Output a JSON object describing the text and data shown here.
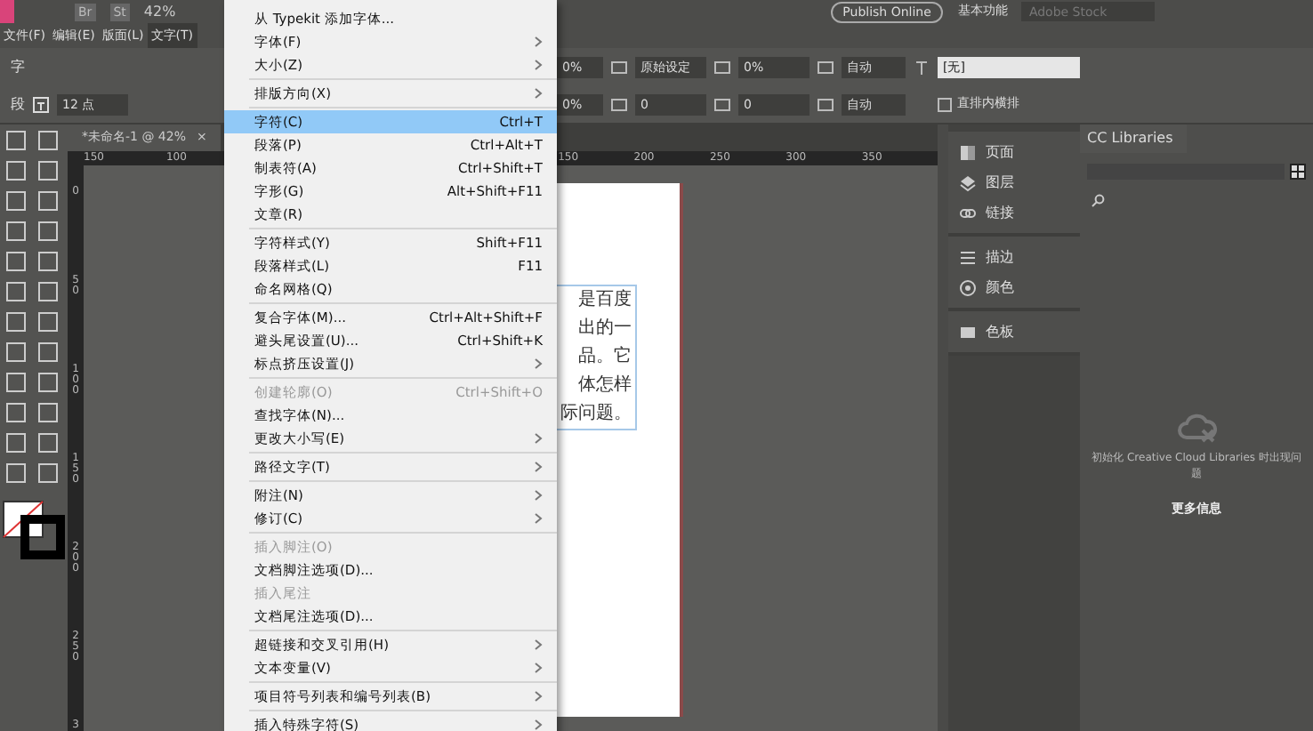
{
  "app_bar": {
    "bridge": "Br",
    "stock": "St",
    "zoom": "42%",
    "publish_button": "Publish Online",
    "workspace": "基本功能",
    "search": {
      "placeholder": "Adobe Stock"
    }
  },
  "menu_bar": [
    {
      "label": "文件(F)",
      "selected": false
    },
    {
      "label": "编辑(E)",
      "selected": false
    },
    {
      "label": "版面(L)",
      "selected": false
    },
    {
      "label": "文字(T)",
      "selected": true
    }
  ],
  "control_panel": {
    "row_1_left_label": "字",
    "row_2_left_label": "段",
    "font_size": "12 点",
    "tracking_percent": "0%",
    "kerning": "原始设定",
    "baseline_percent": "0%",
    "grid_top": "自动",
    "style": "[无]",
    "scale_percent": "0%",
    "tracking": "0",
    "shift": "0",
    "grid_bottom": "自动",
    "tate_chu_yoko": {
      "label": "直排内横排",
      "checked": false
    }
  },
  "document_tab": {
    "title": "*未命名-1 @ 42%",
    "close": "×"
  },
  "horizontal_ruler": {
    "ticks_before_menu": [
      "150",
      "100"
    ],
    "ticks_after_menu": [
      "150",
      "200",
      "250",
      "300",
      "350"
    ]
  },
  "vertical_ruler": {
    "ticks": [
      "0",
      "50",
      "100",
      "150",
      "200",
      "250",
      "3"
    ]
  },
  "page_text": [
    "是百度",
    "出的一",
    "品。它",
    "体怎样",
    "际问题。"
  ],
  "panels": [
    [
      {
        "label": "页面",
        "kind": "pages"
      },
      {
        "label": "图层",
        "kind": "layers"
      },
      {
        "label": "链接",
        "kind": "links"
      }
    ],
    [
      {
        "label": "描边",
        "kind": "stroke"
      },
      {
        "label": "颜色",
        "kind": "color"
      }
    ],
    [
      {
        "label": "色板",
        "kind": "swatches"
      }
    ]
  ],
  "cc_libraries": {
    "title": "CC Libraries",
    "message": "初始化 Creative Cloud Libraries 时出现问题",
    "more_info": "更多信息"
  },
  "type_menu": [
    [
      {
        "label": "从 Typekit 添加字体...",
        "submenu": false,
        "disabled": false,
        "selected": false
      },
      {
        "label": "字体(F)",
        "submenu": true,
        "disabled": false,
        "selected": false
      },
      {
        "label": "大小(Z)",
        "submenu": true,
        "disabled": false,
        "selected": false
      }
    ],
    [
      {
        "label": "排版方向(X)",
        "submenu": true,
        "disabled": false,
        "selected": false
      }
    ],
    [
      {
        "label": "字符(C)",
        "shortcut": "Ctrl+T",
        "submenu": false,
        "disabled": false,
        "selected": true
      },
      {
        "label": "段落(P)",
        "shortcut": "Ctrl+Alt+T",
        "submenu": false,
        "disabled": false,
        "selected": false
      },
      {
        "label": "制表符(A)",
        "shortcut": "Ctrl+Shift+T",
        "submenu": false,
        "disabled": false,
        "selected": false
      },
      {
        "label": "字形(G)",
        "shortcut": "Alt+Shift+F11",
        "submenu": false,
        "disabled": false,
        "selected": false
      },
      {
        "label": "文章(R)",
        "submenu": false,
        "disabled": false,
        "selected": false
      }
    ],
    [
      {
        "label": "字符样式(Y)",
        "shortcut": "Shift+F11",
        "submenu": false,
        "disabled": false,
        "selected": false
      },
      {
        "label": "段落样式(L)",
        "shortcut": "F11",
        "submenu": false,
        "disabled": false,
        "selected": false
      },
      {
        "label": "命名网格(Q)",
        "submenu": false,
        "disabled": false,
        "selected": false
      }
    ],
    [
      {
        "label": "复合字体(M)...",
        "shortcut": "Ctrl+Alt+Shift+F",
        "submenu": false,
        "disabled": false,
        "selected": false
      },
      {
        "label": "避头尾设置(U)...",
        "shortcut": "Ctrl+Shift+K",
        "submenu": false,
        "disabled": false,
        "selected": false
      },
      {
        "label": "标点挤压设置(J)",
        "submenu": true,
        "disabled": false,
        "selected": false
      }
    ],
    [
      {
        "label": "创建轮廓(O)",
        "shortcut": "Ctrl+Shift+O",
        "submenu": false,
        "disabled": true,
        "selected": false
      },
      {
        "label": "查找字体(N)...",
        "submenu": false,
        "disabled": false,
        "selected": false
      },
      {
        "label": "更改大小写(E)",
        "submenu": true,
        "disabled": false,
        "selected": false
      }
    ],
    [
      {
        "label": "路径文字(T)",
        "submenu": true,
        "disabled": false,
        "selected": false
      }
    ],
    [
      {
        "label": "附注(N)",
        "submenu": true,
        "disabled": false,
        "selected": false
      },
      {
        "label": "修订(C)",
        "submenu": true,
        "disabled": false,
        "selected": false
      }
    ],
    [
      {
        "label": "插入脚注(O)",
        "submenu": false,
        "disabled": true,
        "selected": false
      },
      {
        "label": "文档脚注选项(D)...",
        "submenu": false,
        "disabled": false,
        "selected": false
      },
      {
        "label": "插入尾注",
        "submenu": false,
        "disabled": true,
        "selected": false
      },
      {
        "label": "文档尾注选项(D)...",
        "submenu": false,
        "disabled": false,
        "selected": false
      }
    ],
    [
      {
        "label": "超链接和交叉引用(H)",
        "submenu": true,
        "disabled": false,
        "selected": false
      },
      {
        "label": "文本变量(V)",
        "submenu": true,
        "disabled": false,
        "selected": false
      }
    ],
    [
      {
        "label": "项目符号列表和编号列表(B)",
        "submenu": true,
        "disabled": false,
        "selected": false
      }
    ],
    [
      {
        "label": "插入特殊字符(S)",
        "submenu": true,
        "disabled": false,
        "selected": false
      }
    ]
  ]
}
